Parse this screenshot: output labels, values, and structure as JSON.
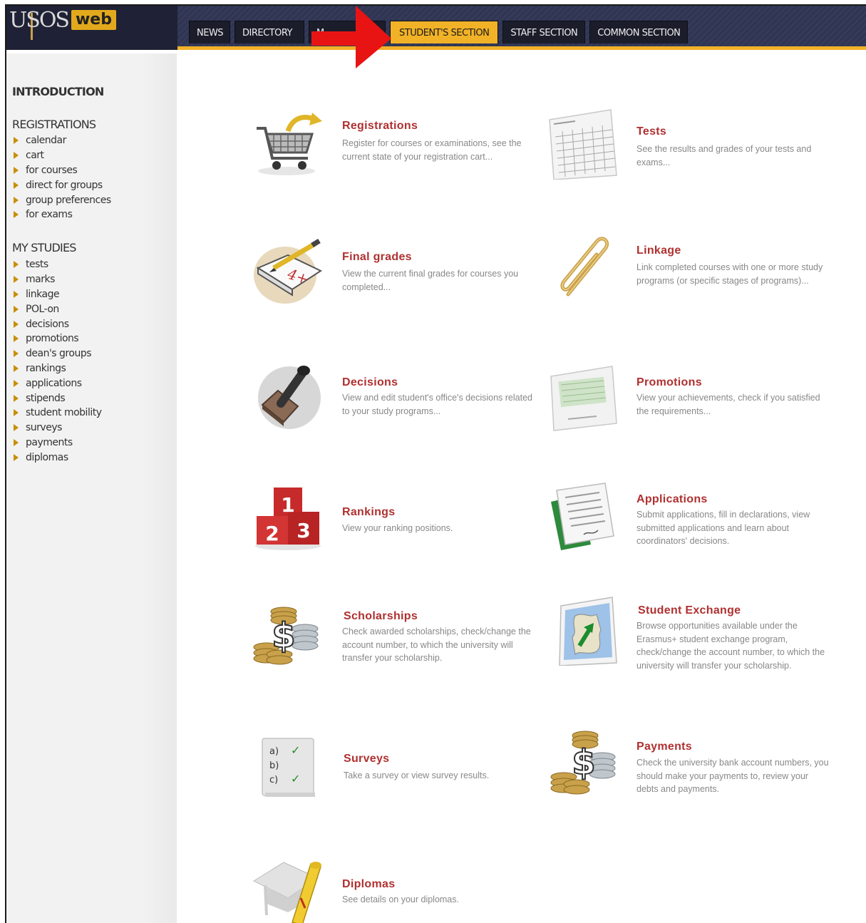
{
  "logo": {
    "mark": "USOS",
    "web": "web"
  },
  "tabs": [
    {
      "label": "NEWS",
      "active": false
    },
    {
      "label": "DIRECTORY",
      "active": false
    },
    {
      "label": "M",
      "active": false
    },
    {
      "label": "STUDENT'S SECTION",
      "active": true
    },
    {
      "label": "STAFF SECTION",
      "active": false
    },
    {
      "label": "COMMON SECTION",
      "active": false
    }
  ],
  "sidebar": {
    "introduction": "INTRODUCTION",
    "registrations": {
      "heading": "REGISTRATIONS",
      "items": [
        "calendar",
        "cart",
        "for courses",
        "direct for groups",
        "group preferences",
        "for exams"
      ]
    },
    "my_studies": {
      "heading": "MY STUDIES",
      "items": [
        "tests",
        "marks",
        "linkage",
        "POL-on",
        "decisions",
        "promotions",
        "dean's groups",
        "rankings",
        "applications",
        "stipends",
        "student mobility",
        "surveys",
        "payments",
        "diplomas"
      ]
    }
  },
  "tiles": [
    {
      "title": "Registrations",
      "desc": "Register for courses or examinations, see the current state of your registration cart...",
      "icon": "shopping-cart-icon"
    },
    {
      "title": "Tests",
      "desc": "See the results and grades of your tests and exams...",
      "icon": "test-sheet-icon"
    },
    {
      "title": "Final grades",
      "desc": "View the current final grades for courses you completed...",
      "icon": "grade-book-icon"
    },
    {
      "title": "Linkage",
      "desc": "Link completed courses with one or more study programs (or specific stages of programs)...",
      "icon": "paperclip-icon"
    },
    {
      "title": "Decisions",
      "desc": "View and edit student's office's decisions related to your study programs...",
      "icon": "stamp-icon"
    },
    {
      "title": "Promotions",
      "desc": "View your achievements, check if you satisfied the requirements...",
      "icon": "certificate-icon"
    },
    {
      "title": "Rankings",
      "desc": "View your ranking positions.",
      "icon": "podium-icon"
    },
    {
      "title": "Applications",
      "desc": "Submit applications, fill in declarations, view submitted applications and learn about coordinators' decisions.",
      "icon": "documents-icon"
    },
    {
      "title": "Scholarships",
      "desc": "Check awarded scholarships, check/change the account number, to which the university will transfer your scholarship.",
      "icon": "coins-dollar-icon"
    },
    {
      "title": "Student Exchange",
      "desc": "Browse opportunities available under the Erasmus+ student exchange program, check/change the account number, to which the university will transfer your scholarship.",
      "icon": "europe-map-icon"
    },
    {
      "title": "Surveys",
      "desc": "Take a survey or view survey results.",
      "icon": "survey-checklist-icon"
    },
    {
      "title": "Payments",
      "desc": "Check the university bank account numbers, you should make your payments to, review your debts and payments.",
      "icon": "coins-dollar-icon"
    },
    {
      "title": "Diplomas",
      "desc": "See details on your diplomas.",
      "icon": "graduation-cap-icon"
    }
  ],
  "survey_icon": {
    "a": "a)",
    "b": "b)",
    "c": "c)",
    "check": "✓"
  },
  "ranking_icon": {
    "first": "1",
    "second": "2",
    "third": "3"
  },
  "grade_icon": {
    "grade": "4+"
  },
  "dollar_sign": "$"
}
